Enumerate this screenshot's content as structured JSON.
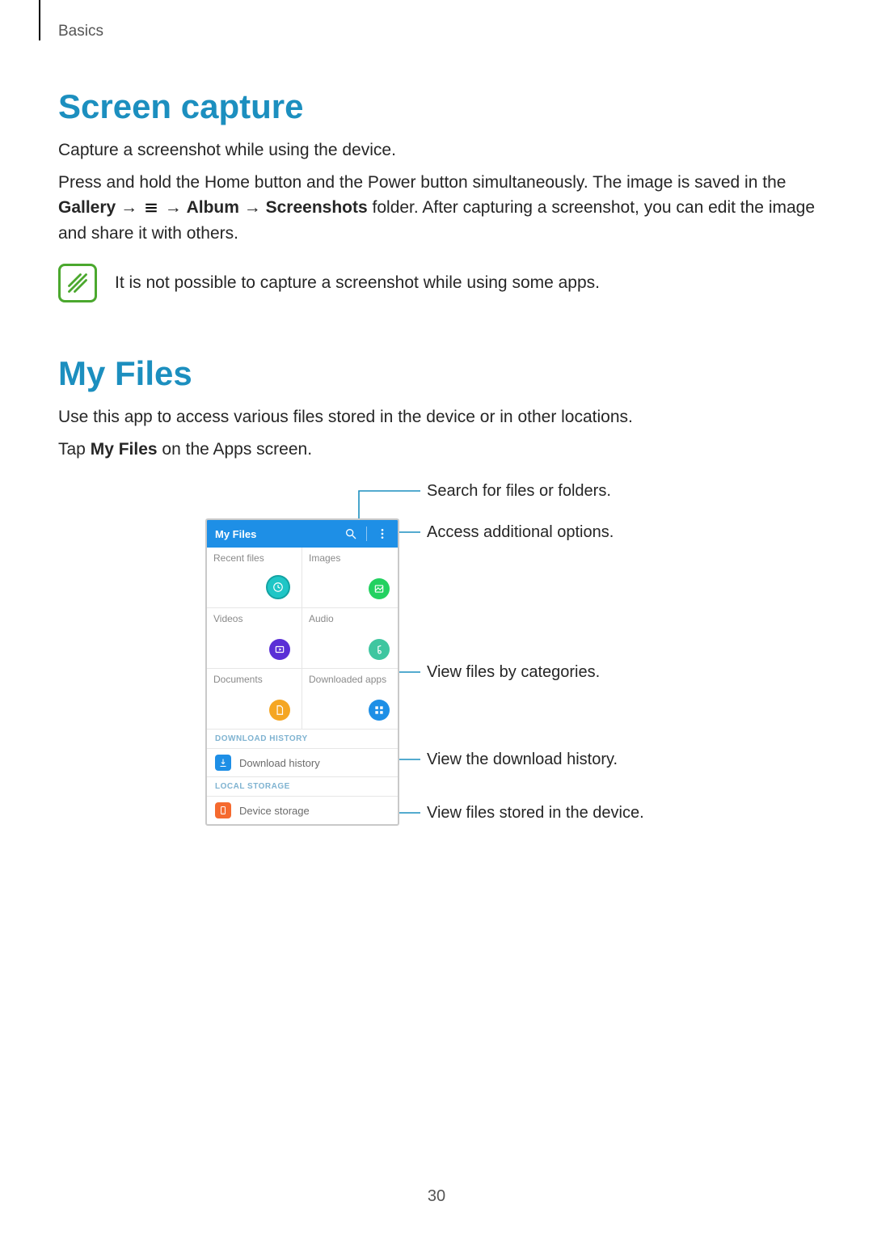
{
  "page": {
    "breadcrumb": "Basics",
    "number": "30"
  },
  "section1": {
    "heading": "Screen capture",
    "p1": "Capture a screenshot while using the device.",
    "p2a": "Press and hold the Home button and the Power button simultaneously. The image is saved in the ",
    "gallery": "Gallery",
    "arrow": " → ",
    "album": "Album",
    "screenshots": "Screenshots",
    "p2b": " folder. After capturing a screenshot, you can edit the image and share it with others.",
    "note": "It is not possible to capture a screenshot while using some apps."
  },
  "section2": {
    "heading": "My Files",
    "p1": "Use this app to access various files stored in the device or in other locations.",
    "p2a": "Tap ",
    "myfiles": "My Files",
    "p2b": " on the Apps screen."
  },
  "phone": {
    "title": "My Files",
    "tiles": {
      "recent": "Recent files",
      "images": "Images",
      "videos": "Videos",
      "audio": "Audio",
      "documents": "Documents",
      "downloaded": "Downloaded apps"
    },
    "sec1": "DOWNLOAD HISTORY",
    "row1": "Download history",
    "sec2": "LOCAL STORAGE",
    "row2": "Device storage"
  },
  "callouts": {
    "search": "Search for files or folders.",
    "options": "Access additional options.",
    "categories": "View files by categories.",
    "history": "View the download history.",
    "storage": "View files stored in the device."
  }
}
